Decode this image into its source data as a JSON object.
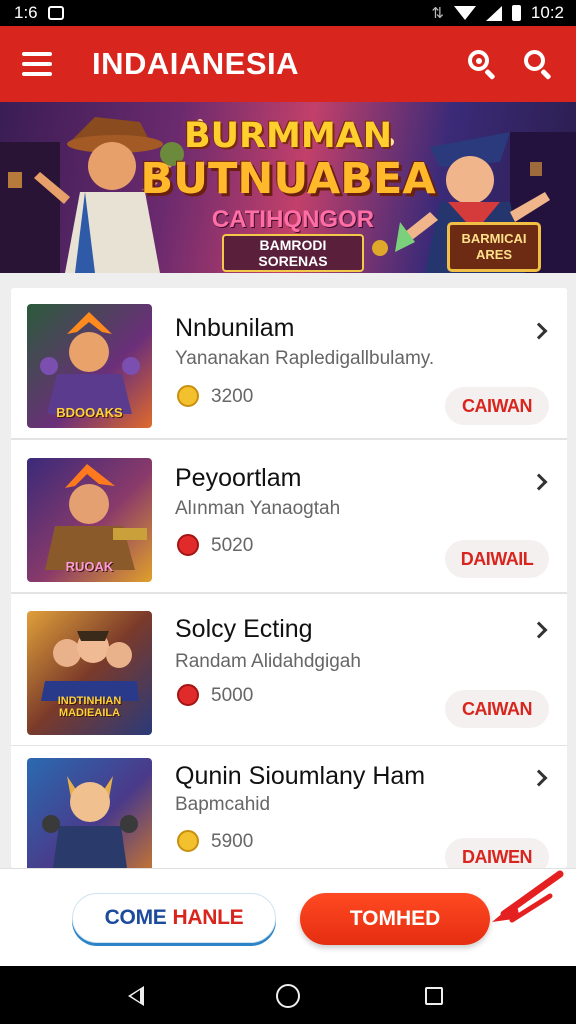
{
  "status_bar": {
    "time_left": "1:6",
    "time_right": "10:2",
    "icons": [
      "photo-icon",
      "vibrate-icon",
      "wifi-icon",
      "signal-icon",
      "battery-icon"
    ]
  },
  "app_bar": {
    "title": "INDAIANESIA",
    "icons": [
      "menu-icon",
      "search-focus-icon",
      "search-icon"
    ]
  },
  "banner": {
    "line1": "BURMMAN",
    "line2": "BUTNUABEA",
    "line3": "CATIHQNGOR",
    "line4": "BAMRODI SORENAS",
    "badge": "BARMICAI ARES"
  },
  "items": [
    {
      "title": "Nnbunilam",
      "subtitle": "Yananakan Rapledigallbulamy.",
      "price": "3200",
      "coin": "gold",
      "button": "CAIWAN",
      "thumb_label": "BDOOAKS"
    },
    {
      "title": "Peyoortlam",
      "subtitle": "Alınman Yanaogtah",
      "price": "5020",
      "coin": "red",
      "button": "DAIWAIL",
      "thumb_label": "RUOAK"
    },
    {
      "title": "Solcy Ecting",
      "subtitle": "Randam Alidahdgigah",
      "price": "5000",
      "coin": "red",
      "button": "CAIWAN",
      "thumb_label": "INDTINHIAN MADIEAILA"
    },
    {
      "title": "Qunin Sioumlany Ham",
      "subtitle": "Bapmcahid",
      "price": "5900",
      "coin": "gold",
      "button": "DAIWEN",
      "thumb_label": ""
    }
  ],
  "actions": {
    "secondary_word1": "COME",
    "secondary_word2": "HANLE",
    "primary": "TOMHED"
  },
  "colors": {
    "brand_red": "#d8261f",
    "primary_button": "#ff4a22",
    "secondary_accent": "#2c84c7"
  }
}
